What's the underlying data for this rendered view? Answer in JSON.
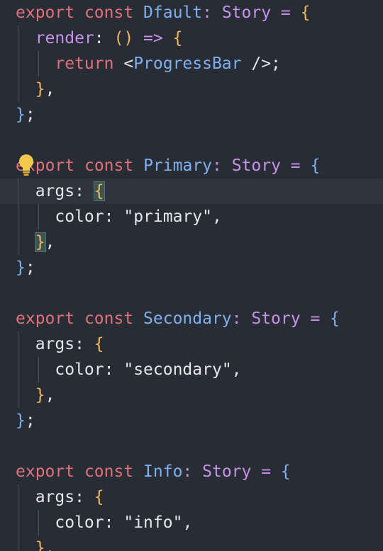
{
  "editor": {
    "lines": [
      {
        "tokens": [
          {
            "t": "export ",
            "c": "kw"
          },
          {
            "t": "const ",
            "c": "kw"
          },
          {
            "t": "Dfault",
            "c": "fn"
          },
          {
            "t": ": ",
            "c": "op"
          },
          {
            "t": "Story",
            "c": "type"
          },
          {
            "t": " = ",
            "c": "op"
          },
          {
            "t": "{",
            "c": "brace"
          }
        ]
      },
      {
        "tokens": [
          {
            "t": "  ",
            "c": "plain"
          },
          {
            "t": "render",
            "c": "rend"
          },
          {
            "t": ": ",
            "c": "plain"
          },
          {
            "t": "() ",
            "c": "brace"
          },
          {
            "t": "=> ",
            "c": "op"
          },
          {
            "t": "{",
            "c": "brace"
          }
        ]
      },
      {
        "tokens": [
          {
            "t": "    ",
            "c": "plain"
          },
          {
            "t": "return ",
            "c": "ret"
          },
          {
            "t": "<",
            "c": "plain"
          },
          {
            "t": "ProgressBar",
            "c": "tag"
          },
          {
            "t": " />;",
            "c": "plain"
          }
        ]
      },
      {
        "tokens": [
          {
            "t": "  ",
            "c": "plain"
          },
          {
            "t": "}",
            "c": "brace"
          },
          {
            "t": ",",
            "c": "plain"
          }
        ]
      },
      {
        "tokens": [
          {
            "t": "}",
            "c": "fn"
          },
          {
            "t": ";",
            "c": "plain"
          }
        ]
      },
      {
        "tokens": []
      },
      {
        "tokens": [
          {
            "t": "e",
            "c": "kw"
          },
          {
            "t": "x",
            "c": "kw"
          },
          {
            "t": "port ",
            "c": "kw"
          },
          {
            "t": "const ",
            "c": "kw"
          },
          {
            "t": "Primary",
            "c": "fn"
          },
          {
            "t": ": ",
            "c": "op"
          },
          {
            "t": "Story",
            "c": "type"
          },
          {
            "t": " = ",
            "c": "op"
          },
          {
            "t": "{",
            "c": "fn"
          }
        ]
      },
      {
        "tokens": [
          {
            "t": "  ",
            "c": "plain"
          },
          {
            "t": "args",
            "c": "key"
          },
          {
            "t": ": ",
            "c": "plain"
          },
          {
            "t": "{",
            "c": "brace",
            "m": true
          }
        ],
        "active": true
      },
      {
        "tokens": [
          {
            "t": "    ",
            "c": "plain"
          },
          {
            "t": "color",
            "c": "key"
          },
          {
            "t": ": ",
            "c": "plain"
          },
          {
            "t": "\"primary\"",
            "c": "str"
          },
          {
            "t": ",",
            "c": "plain"
          }
        ]
      },
      {
        "tokens": [
          {
            "t": "  ",
            "c": "plain"
          },
          {
            "t": "}",
            "c": "brace",
            "m": true
          },
          {
            "t": ",",
            "c": "plain"
          }
        ]
      },
      {
        "tokens": [
          {
            "t": "}",
            "c": "fn"
          },
          {
            "t": ";",
            "c": "plain"
          }
        ]
      },
      {
        "tokens": []
      },
      {
        "tokens": [
          {
            "t": "export ",
            "c": "kw"
          },
          {
            "t": "const ",
            "c": "kw"
          },
          {
            "t": "Secondary",
            "c": "fn"
          },
          {
            "t": ": ",
            "c": "op"
          },
          {
            "t": "Story",
            "c": "type"
          },
          {
            "t": " = ",
            "c": "op"
          },
          {
            "t": "{",
            "c": "fn"
          }
        ]
      },
      {
        "tokens": [
          {
            "t": "  ",
            "c": "plain"
          },
          {
            "t": "args",
            "c": "key"
          },
          {
            "t": ": ",
            "c": "plain"
          },
          {
            "t": "{",
            "c": "brace"
          }
        ]
      },
      {
        "tokens": [
          {
            "t": "    ",
            "c": "plain"
          },
          {
            "t": "color",
            "c": "key"
          },
          {
            "t": ": ",
            "c": "plain"
          },
          {
            "t": "\"secondary\"",
            "c": "str"
          },
          {
            "t": ",",
            "c": "plain"
          }
        ]
      },
      {
        "tokens": [
          {
            "t": "  ",
            "c": "plain"
          },
          {
            "t": "}",
            "c": "brace"
          },
          {
            "t": ",",
            "c": "plain"
          }
        ]
      },
      {
        "tokens": [
          {
            "t": "}",
            "c": "fn"
          },
          {
            "t": ";",
            "c": "plain"
          }
        ]
      },
      {
        "tokens": []
      },
      {
        "tokens": [
          {
            "t": "export ",
            "c": "kw"
          },
          {
            "t": "const ",
            "c": "kw"
          },
          {
            "t": "Info",
            "c": "fn"
          },
          {
            "t": ": ",
            "c": "op"
          },
          {
            "t": "Story",
            "c": "type"
          },
          {
            "t": " = ",
            "c": "op"
          },
          {
            "t": "{",
            "c": "fn"
          }
        ]
      },
      {
        "tokens": [
          {
            "t": "  ",
            "c": "plain"
          },
          {
            "t": "args",
            "c": "key"
          },
          {
            "t": ": ",
            "c": "plain"
          },
          {
            "t": "{",
            "c": "brace"
          }
        ]
      },
      {
        "tokens": [
          {
            "t": "    ",
            "c": "plain"
          },
          {
            "t": "color",
            "c": "key"
          },
          {
            "t": ": ",
            "c": "plain"
          },
          {
            "t": "\"info\"",
            "c": "str"
          },
          {
            "t": ",",
            "c": "plain"
          }
        ]
      },
      {
        "tokens": [
          {
            "t": "  ",
            "c": "plain"
          },
          {
            "t": "},",
            "c": "brace"
          }
        ]
      }
    ],
    "lightbulb_icon": "lightbulb-icon",
    "colors": {
      "background": "#282c34",
      "keyword": "#e0707a",
      "identifier": "#7fb0ef",
      "type": "#c792ea",
      "brace": "#f0b85a",
      "text": "#e6e6e6",
      "bracket_match": "#3d5552",
      "lightbulb": "#f2c94c"
    }
  }
}
